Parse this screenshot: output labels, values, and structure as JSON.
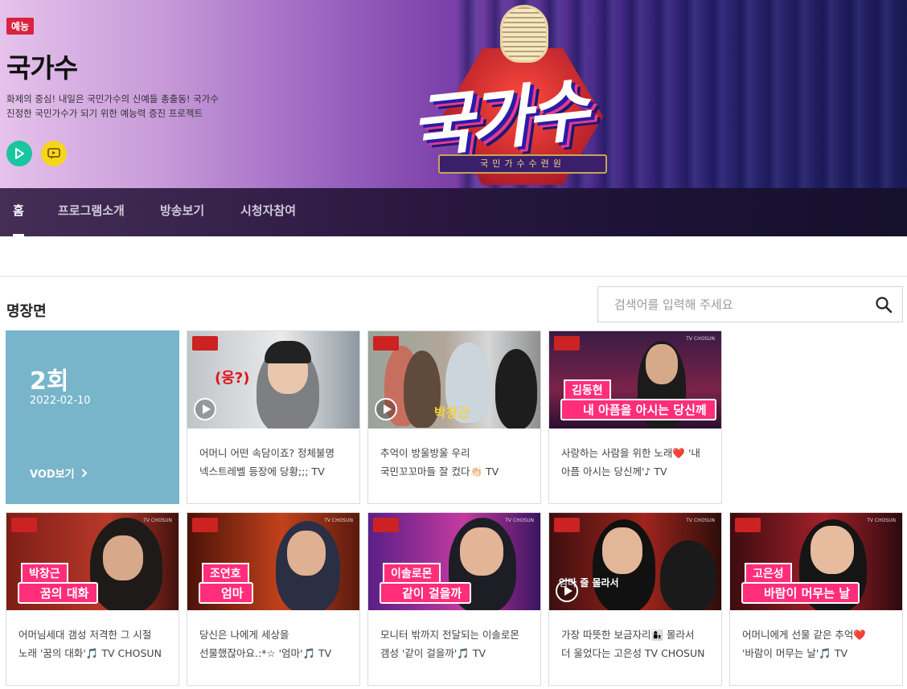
{
  "program": {
    "genre": "예능",
    "title": "국가수",
    "description_line1": "화제의 중심! 내일은 국민가수의 신예들 총출동! 국가수",
    "description_line2": "진정한 국민가수가 되기 위한 예능력 증진 프로젝트",
    "logo_text": "국가수",
    "logo_band": "국민가수수련원"
  },
  "nav": {
    "items": [
      "홈",
      "프로그램소개",
      "방송보기",
      "시청자참여"
    ],
    "active": "홈"
  },
  "section": {
    "title": "명장면"
  },
  "search": {
    "placeholder": "검색어를 입력해 주세요"
  },
  "episode": {
    "number": "2회",
    "date": "2022-02-10",
    "vod_label": "VOD보기"
  },
  "clips": [
    {
      "line1": "어머니 어떤 속담이죠? 정체불명",
      "line2": "넥스트레벨 등장에 당황;;; TV",
      "overlay": "(웅?)"
    },
    {
      "line1": "추억이 방울방울 우리",
      "line2": "국민꼬꼬마들 잘 컸다👏🏻 TV",
      "overlay": "박창근"
    },
    {
      "line1": "사랑하는 사람을 위한 노래❤️ '내",
      "line2": "아픔 아시는 당신께'♪ TV",
      "name": "김동현",
      "song": "내 아픔을 아시는 당신께"
    },
    {
      "line1": "어머님세대 갬성 저격한 그 시절",
      "line2": "노래 '꿈의 대화'🎵 TV CHOSUN",
      "name": "박창근",
      "song": "꿈의 대화"
    },
    {
      "line1": "당신은 나에게 세상을",
      "line2": "선물했잖아요.:*☆ '엄마'🎵 TV",
      "name": "조연호",
      "song": "엄마"
    },
    {
      "line1": "모니터 밖까지 전달되는 이솔로몬",
      "line2": "갬성 '같이 걸을까'🎵 TV",
      "name": "이솔로몬",
      "song": "같이 걸을까"
    },
    {
      "line1": "가장 따뜻한 보금자리👩‍👦 몰라서",
      "line2": "더 울었다는 고은성 TV CHOSUN",
      "overlay": "엄마 줄 몰라서"
    },
    {
      "line1": "어머니에게 선물 같은 추억❤️",
      "line2": "'바람이 머무는 날'🎵 TV",
      "name": "고은성",
      "song": "바람이 머무는 날"
    }
  ],
  "colors": {
    "accent_pink": "#ff2d7a",
    "episode_bg": "#78b5cb",
    "genre_badge": "#d8243f",
    "play_icon_bg": "#19c6a0",
    "talk_icon_bg": "#f7d51d"
  }
}
